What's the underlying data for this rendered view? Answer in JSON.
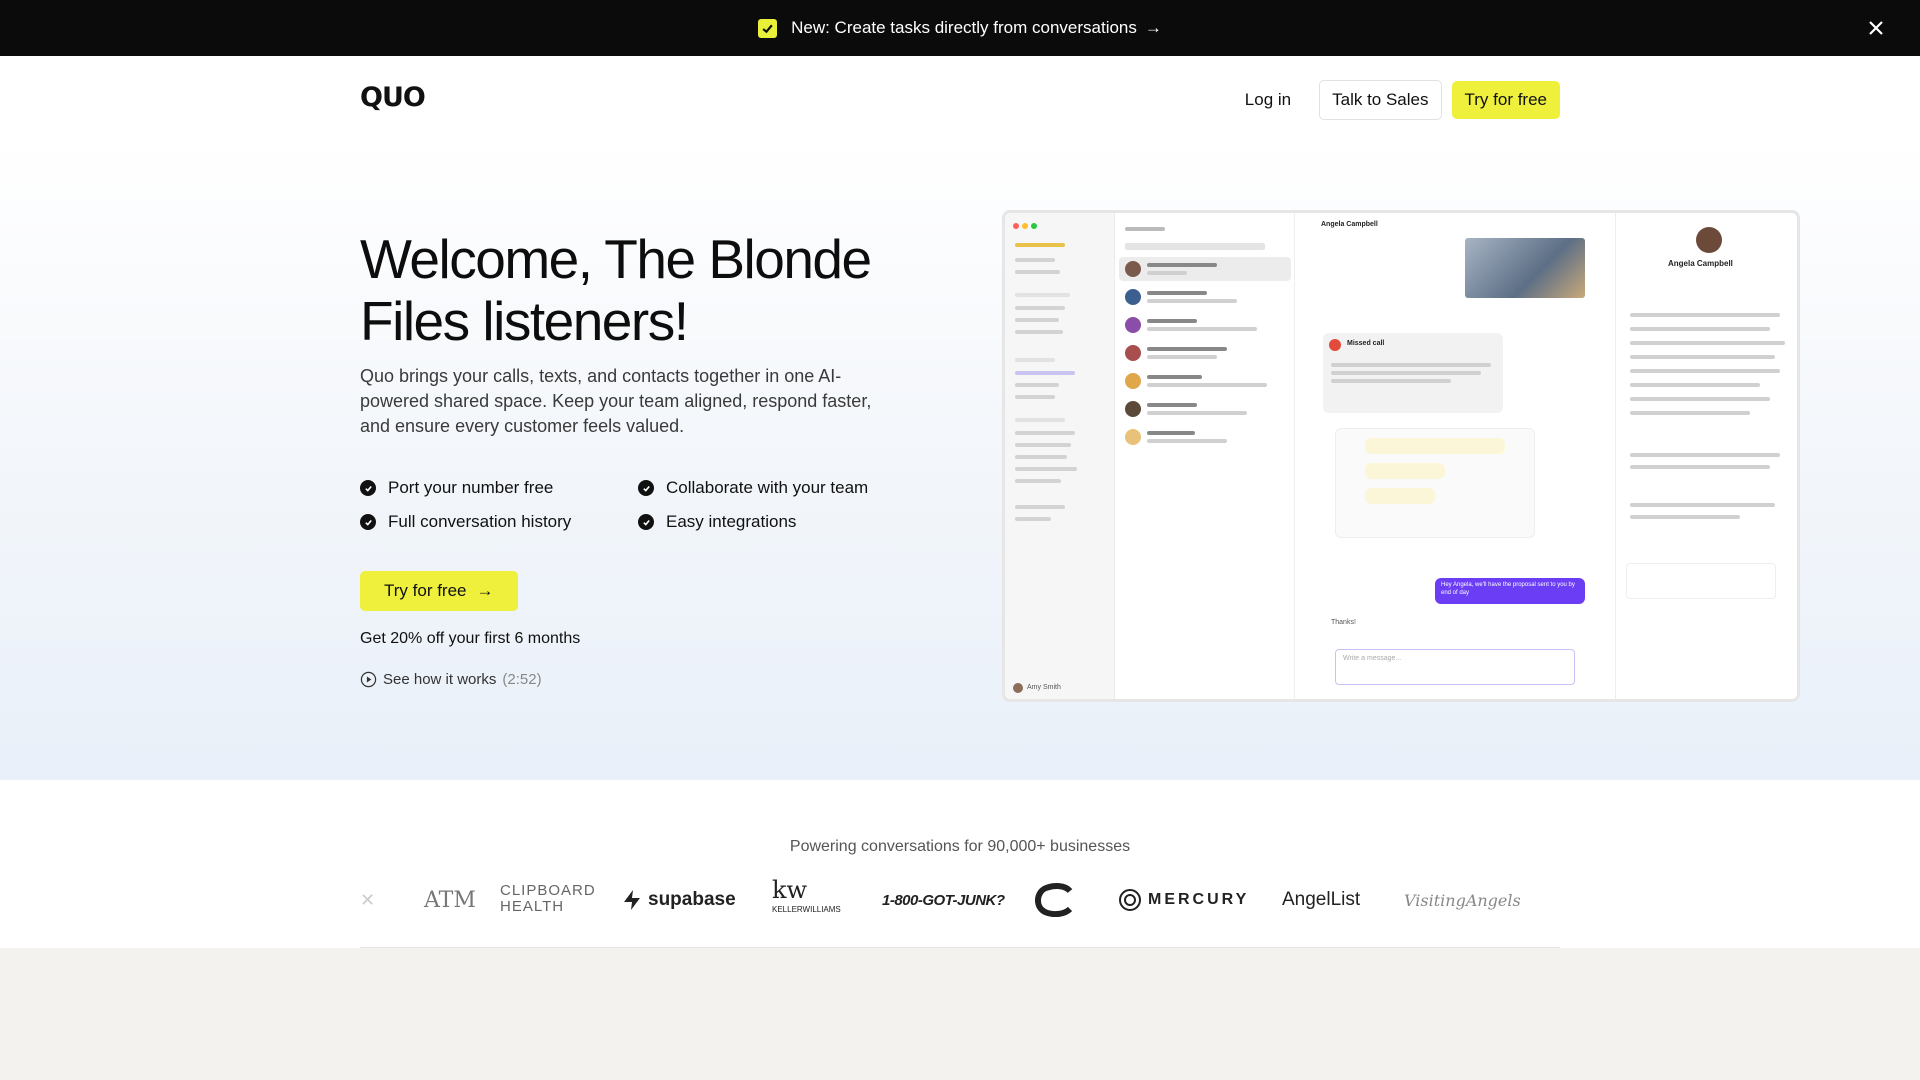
{
  "announcement": {
    "text": "New: Create tasks directly from conversations",
    "arrow": "→",
    "icon": "checkbox-icon",
    "accent": "#e8f03a"
  },
  "header": {
    "logo": "QUO",
    "login": "Log in",
    "talk_to_sales": "Talk to Sales",
    "try_free": "Try for free"
  },
  "hero": {
    "title": "Welcome, The Blonde Files listeners!",
    "subtitle": "Quo brings your calls, texts, and contacts together in one AI-powered shared space. Keep your team aligned, respond faster, and ensure every customer feels valued.",
    "features": [
      "Port your number free",
      "Collaborate with your team",
      "Full conversation history",
      "Easy integrations"
    ],
    "cta": "Try for free",
    "cta_arrow": "→",
    "discount": "Get 20% off your first 6 months",
    "see_how": "See how it works",
    "duration": "(2:52)"
  },
  "mockup": {
    "contact_name": "Angela Campbell",
    "chat_header": "Angela Campbell",
    "missed_call": "Missed call",
    "message_placeholder": "Write a message...",
    "user_name": "Amy Smith",
    "outgoing_msg": "Hey Angela, we'll have the proposal sent to you by end of day",
    "reply": "Thanks!"
  },
  "logos": {
    "heading": "Powering conversations for 90,000+ businesses",
    "items": [
      "ATM",
      "CLIPBOARD",
      "HEALTH",
      "supabase",
      "kw",
      "KELLERWILLIAMS",
      "1-800-GOT-JUNK?",
      "MERCURY",
      "AngelList",
      "VisitingAngels"
    ]
  },
  "colors": {
    "accent_yellow": "#eef03c",
    "dark": "#0b0b0b",
    "purple": "#6b3df5"
  }
}
